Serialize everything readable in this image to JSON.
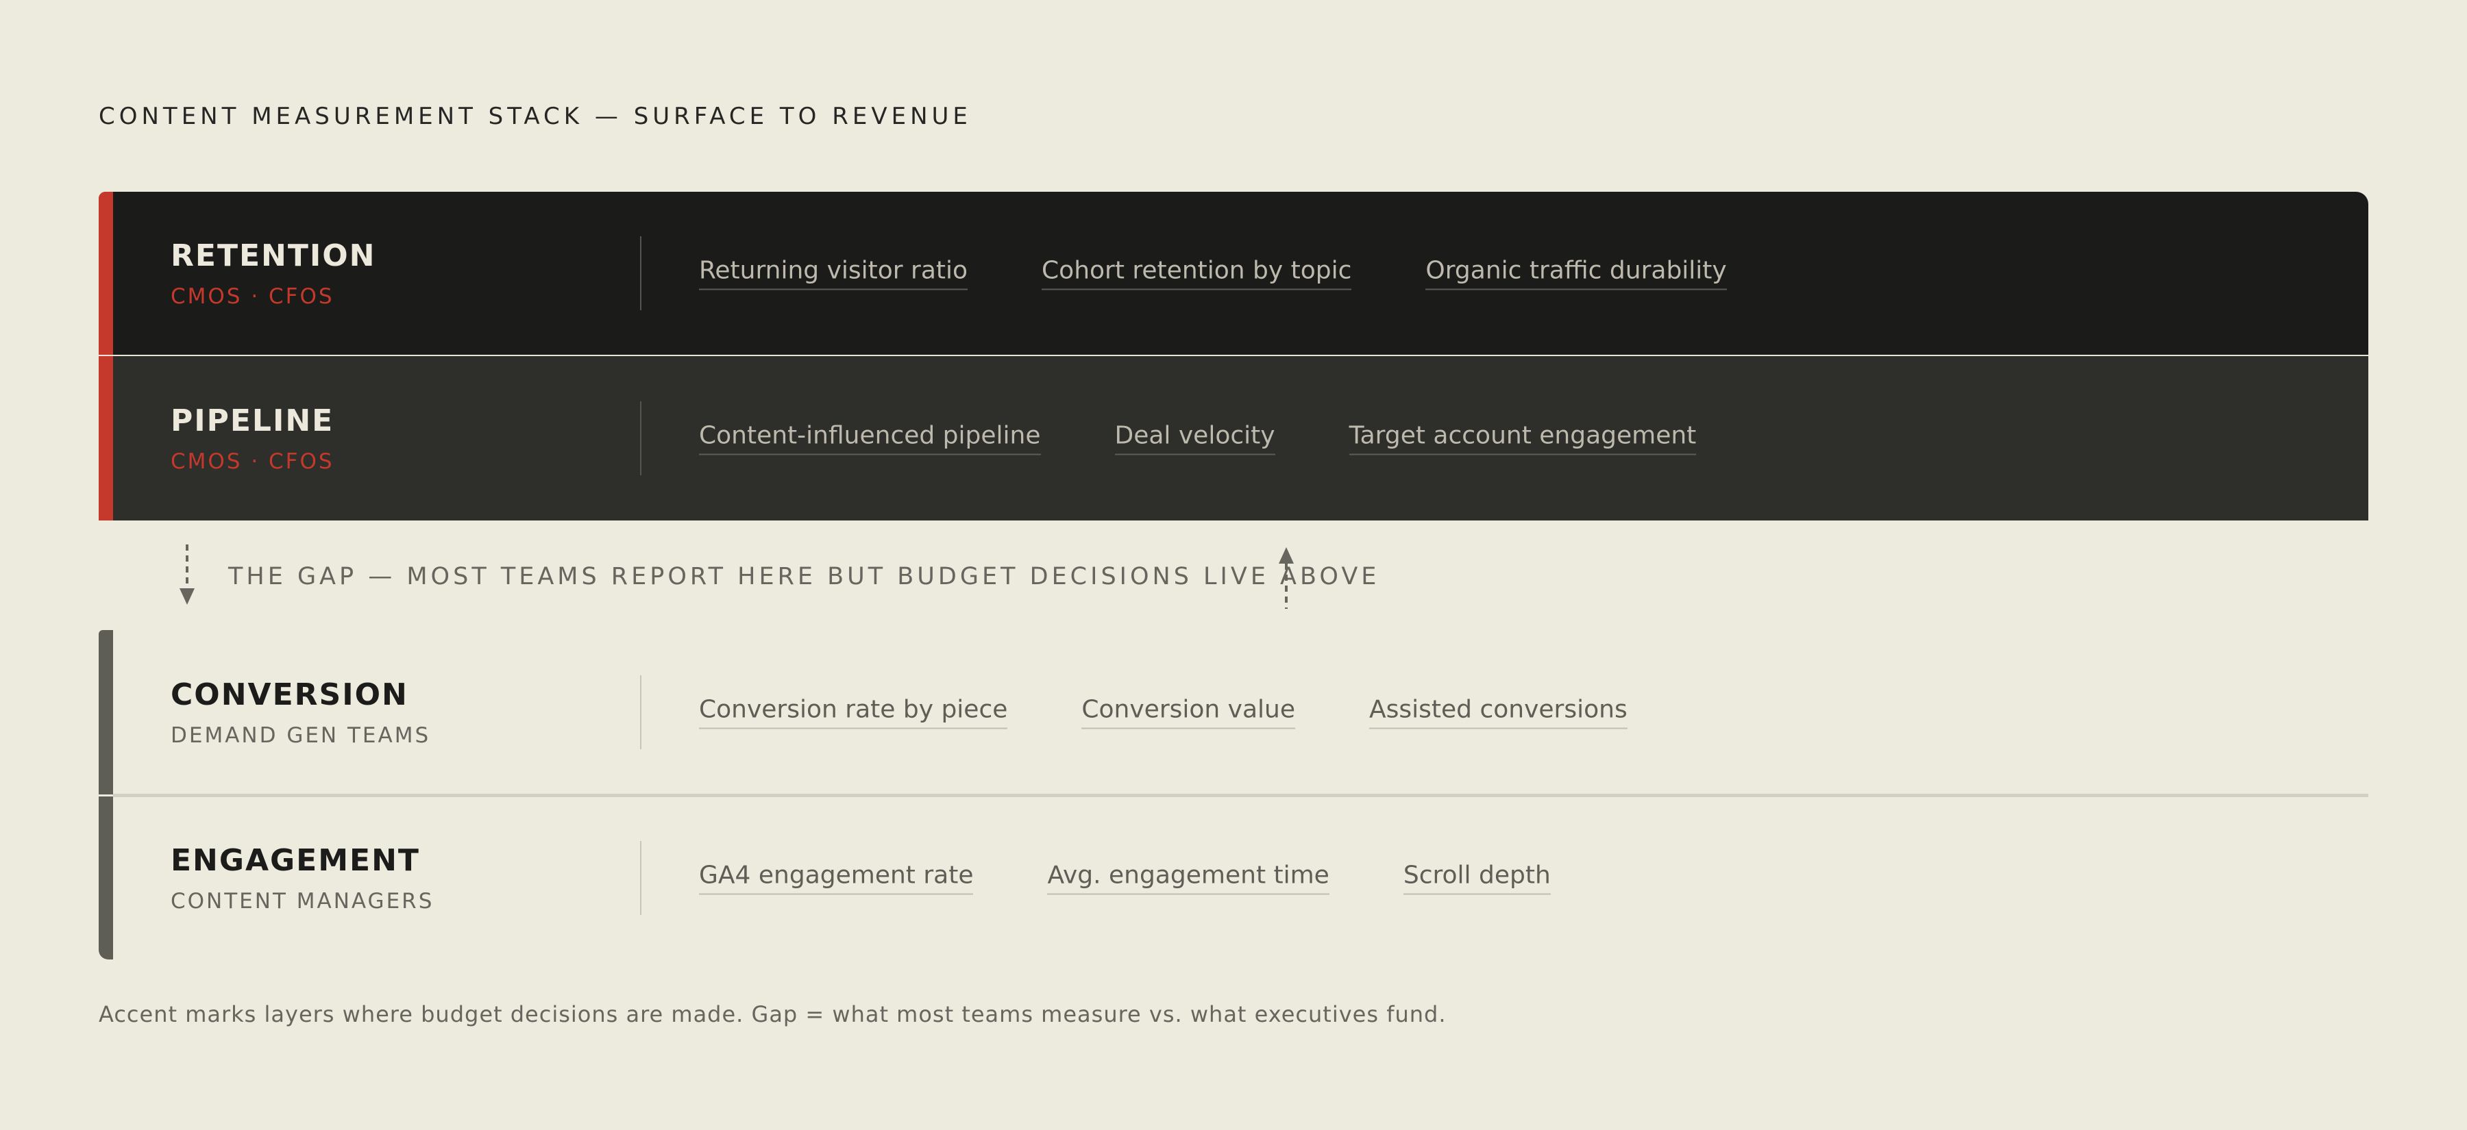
{
  "title": "CONTENT MEASUREMENT STACK — SURFACE TO REVENUE",
  "colors": {
    "background": "#edeade",
    "accent_red": "#c5392c",
    "accent_gray": "#5e5e57",
    "dark_layer_1": "#1b1b19",
    "dark_layer_2": "#2e2e2a"
  },
  "layers": [
    {
      "name": "RETENTION",
      "audience": "CMOS · CFOS",
      "metrics": [
        "Returning visitor ratio",
        "Cohort retention by topic",
        "Organic traffic durability"
      ]
    },
    {
      "name": "PIPELINE",
      "audience": "CMOS · CFOS",
      "metrics": [
        "Content-influenced pipeline",
        "Deal velocity",
        "Target account engagement"
      ]
    },
    {
      "name": "CONVERSION",
      "audience": "DEMAND GEN TEAMS",
      "metrics": [
        "Conversion rate by piece",
        "Conversion value",
        "Assisted conversions"
      ]
    },
    {
      "name": "ENGAGEMENT",
      "audience": "CONTENT MANAGERS",
      "metrics": [
        "GA4 engagement rate",
        "Avg. engagement time",
        "Scroll depth"
      ]
    }
  ],
  "gap": {
    "text": "THE GAP — MOST TEAMS REPORT HERE BUT BUDGET DECISIONS LIVE ABOVE",
    "left_icon": "arrow-down-dashed-icon",
    "right_icon": "arrow-up-dashed-icon"
  },
  "footnote": "Accent marks layers where budget decisions are made. Gap = what most teams measure vs. what executives fund."
}
